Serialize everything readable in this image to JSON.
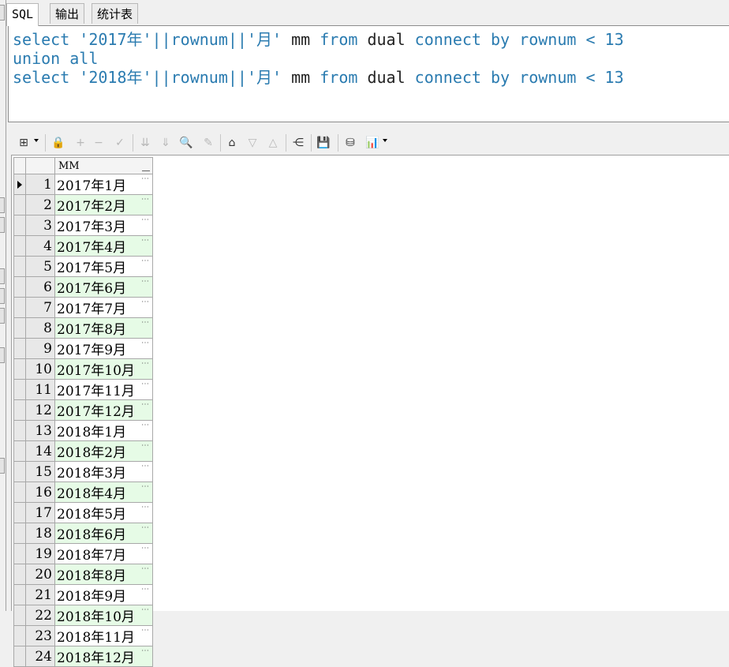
{
  "tabs": [
    {
      "label": "SQL",
      "active": true
    },
    {
      "label": "输出",
      "active": false
    },
    {
      "label": "统计表",
      "active": false
    }
  ],
  "editor": {
    "lines": [
      [
        {
          "t": "select",
          "c": "kw"
        },
        {
          "t": " ",
          "c": "sp"
        },
        {
          "t": "'2017年'",
          "c": "str"
        },
        {
          "t": "||",
          "c": "op"
        },
        {
          "t": "rownum",
          "c": "kw"
        },
        {
          "t": "||",
          "c": "op"
        },
        {
          "t": "'月'",
          "c": "str"
        },
        {
          "t": " mm ",
          "c": "id"
        },
        {
          "t": "from",
          "c": "kw"
        },
        {
          "t": " dual ",
          "c": "id"
        },
        {
          "t": "connect",
          "c": "kw"
        },
        {
          "t": " ",
          "c": "sp"
        },
        {
          "t": "by",
          "c": "kw"
        },
        {
          "t": " ",
          "c": "sp"
        },
        {
          "t": "rownum",
          "c": "kw"
        },
        {
          "t": " < ",
          "c": "op"
        },
        {
          "t": "13",
          "c": "num"
        }
      ],
      [
        {
          "t": "union all",
          "c": "kw"
        }
      ],
      [
        {
          "t": "select",
          "c": "kw"
        },
        {
          "t": " ",
          "c": "sp"
        },
        {
          "t": "'2018年'",
          "c": "str"
        },
        {
          "t": "||",
          "c": "op"
        },
        {
          "t": "rownum",
          "c": "kw"
        },
        {
          "t": "||",
          "c": "op"
        },
        {
          "t": "'月'",
          "c": "str"
        },
        {
          "t": " mm ",
          "c": "id"
        },
        {
          "t": "from",
          "c": "kw"
        },
        {
          "t": " dual ",
          "c": "id"
        },
        {
          "t": "connect",
          "c": "kw"
        },
        {
          "t": " ",
          "c": "sp"
        },
        {
          "t": "by",
          "c": "kw"
        },
        {
          "t": " ",
          "c": "sp"
        },
        {
          "t": "rownum",
          "c": "kw"
        },
        {
          "t": " < ",
          "c": "op"
        },
        {
          "t": "13",
          "c": "num"
        }
      ]
    ]
  },
  "toolbar": {
    "buttons": [
      {
        "name": "grid-options-icon",
        "glyph": "⊞",
        "enabled": true,
        "dropdown": true
      },
      {
        "name": "lock-icon",
        "glyph": "🔒",
        "enabled": true
      },
      {
        "name": "insert-record-icon",
        "glyph": "+",
        "enabled": false
      },
      {
        "name": "delete-record-icon",
        "glyph": "−",
        "enabled": false
      },
      {
        "name": "post-changes-icon",
        "glyph": "✓",
        "enabled": false
      },
      {
        "name": "fetch-next-page-icon",
        "glyph": "⇊",
        "enabled": false
      },
      {
        "name": "fetch-last-page-icon",
        "glyph": "⇓",
        "enabled": false
      },
      {
        "name": "find-icon",
        "glyph": "🔍",
        "enabled": true
      },
      {
        "name": "clear-icon",
        "glyph": "✎",
        "enabled": false
      },
      {
        "name": "query-by-example-icon",
        "glyph": "⌂",
        "enabled": true
      },
      {
        "name": "next-record-icon",
        "glyph": "▽",
        "enabled": false
      },
      {
        "name": "previous-record-icon",
        "glyph": "△",
        "enabled": false
      },
      {
        "name": "connect-icon",
        "glyph": "⋲",
        "enabled": true
      },
      {
        "name": "save-icon",
        "glyph": "💾",
        "enabled": true
      },
      {
        "name": "export-icon",
        "glyph": "⛁",
        "enabled": true
      },
      {
        "name": "chart-icon",
        "glyph": "📊",
        "enabled": true,
        "dropdown": true
      }
    ]
  },
  "grid": {
    "column_header": "MM",
    "rows": [
      {
        "n": "1",
        "mm": "2017年1月"
      },
      {
        "n": "2",
        "mm": "2017年2月"
      },
      {
        "n": "3",
        "mm": "2017年3月"
      },
      {
        "n": "4",
        "mm": "2017年4月"
      },
      {
        "n": "5",
        "mm": "2017年5月"
      },
      {
        "n": "6",
        "mm": "2017年6月"
      },
      {
        "n": "7",
        "mm": "2017年7月"
      },
      {
        "n": "8",
        "mm": "2017年8月"
      },
      {
        "n": "9",
        "mm": "2017年9月"
      },
      {
        "n": "10",
        "mm": "2017年10月"
      },
      {
        "n": "11",
        "mm": "2017年11月"
      },
      {
        "n": "12",
        "mm": "2017年12月"
      },
      {
        "n": "13",
        "mm": "2018年1月"
      },
      {
        "n": "14",
        "mm": "2018年2月"
      },
      {
        "n": "15",
        "mm": "2018年3月"
      },
      {
        "n": "16",
        "mm": "2018年4月"
      },
      {
        "n": "17",
        "mm": "2018年5月"
      },
      {
        "n": "18",
        "mm": "2018年6月"
      },
      {
        "n": "19",
        "mm": "2018年7月"
      },
      {
        "n": "20",
        "mm": "2018年8月"
      },
      {
        "n": "21",
        "mm": "2018年9月"
      },
      {
        "n": "22",
        "mm": "2018年10月"
      },
      {
        "n": "23",
        "mm": "2018年11月"
      },
      {
        "n": "24",
        "mm": "2018年12月"
      }
    ],
    "cell_button_glyph": "⋯"
  },
  "colors": {
    "keyword": "#2a7bb0",
    "alt_row": "#e6fbe6"
  }
}
